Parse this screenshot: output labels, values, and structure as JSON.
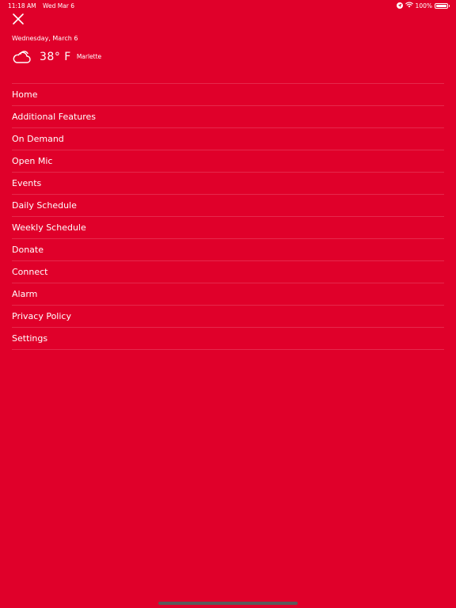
{
  "status_bar": {
    "time": "11:18 AM",
    "date": "Wed Mar 6",
    "battery": "100%",
    "battery_level": 1.0
  },
  "icons": {
    "close": "close-icon",
    "weather": "cloud-icon",
    "location": "location-icon",
    "wifi": "wifi-icon",
    "battery": "battery-icon"
  },
  "header": {
    "date": "Wednesday, March 6"
  },
  "weather": {
    "temperature": "38° F",
    "location": "Marlette"
  },
  "menu": {
    "items": [
      {
        "label": "Home"
      },
      {
        "label": "Additional Features"
      },
      {
        "label": "On Demand"
      },
      {
        "label": "Open Mic"
      },
      {
        "label": "Events"
      },
      {
        "label": "Daily Schedule"
      },
      {
        "label": "Weekly Schedule"
      },
      {
        "label": "Donate"
      },
      {
        "label": "Connect"
      },
      {
        "label": "Alarm"
      },
      {
        "label": "Privacy Policy"
      },
      {
        "label": "Settings"
      }
    ]
  },
  "colors": {
    "background": "#e0002a",
    "text": "#ffffff",
    "home_indicator": "#5a5a5a"
  }
}
